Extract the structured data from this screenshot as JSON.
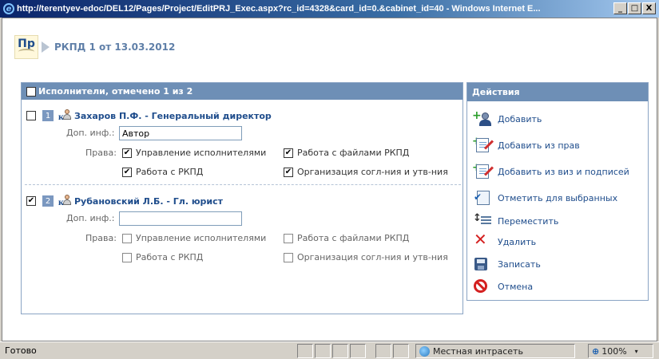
{
  "window": {
    "title": "http://terentyev-edoc/DEL12/Pages/Project/EditPRJ_Exec.aspx?rc_id=4328&card_id=0.&cabinet_id=40 - Windows Internet E...",
    "minimize": "_",
    "maximize": "□",
    "close": "X"
  },
  "doc": {
    "badge": "Пр",
    "title": "РКПД 1 от 13.03.2012"
  },
  "executors": {
    "header": "Исполнители, отмечено 1 из 2",
    "info_label": "Доп. инф.:",
    "rights_label": "Права:",
    "people": [
      {
        "num": "1",
        "name": "Захаров П.Ф. - Генеральный директор",
        "checked": false,
        "info": "Автор",
        "rights": [
          {
            "label": "Управление исполнителями",
            "checked": true
          },
          {
            "label": "Работа с файлами РКПД",
            "checked": true
          },
          {
            "label": "Работа с РКПД",
            "checked": true
          },
          {
            "label": "Организация согл-ния и утв-ния",
            "checked": true
          }
        ]
      },
      {
        "num": "2",
        "name": "Рубановский Л.Б. - Гл. юрист",
        "checked": true,
        "info": "",
        "rights": [
          {
            "label": "Управление исполнителями",
            "checked": false
          },
          {
            "label": "Работа с файлами РКПД",
            "checked": false
          },
          {
            "label": "Работа с РКПД",
            "checked": false
          },
          {
            "label": "Организация согл-ния и утв-ния",
            "checked": false
          }
        ]
      }
    ]
  },
  "actions": {
    "header": "Действия",
    "items": [
      {
        "label": "Добавить",
        "icon": "add-person-icon"
      },
      {
        "label": "Добавить из прав",
        "icon": "add-from-rights-icon"
      },
      {
        "label": "Добавить из виз и подписей",
        "icon": "add-from-signatures-icon"
      },
      {
        "label": "Отметить для выбранных",
        "icon": "mark-selected-icon"
      },
      {
        "label": "Переместить",
        "icon": "move-icon"
      },
      {
        "label": "Удалить",
        "icon": "delete-icon"
      },
      {
        "label": "Записать",
        "icon": "save-icon"
      },
      {
        "label": "Отмена",
        "icon": "cancel-icon"
      }
    ]
  },
  "status": {
    "text": "Готово",
    "zone": "Местная интрасеть",
    "zoom": "100%",
    "zoom_dropdown": "▾"
  }
}
